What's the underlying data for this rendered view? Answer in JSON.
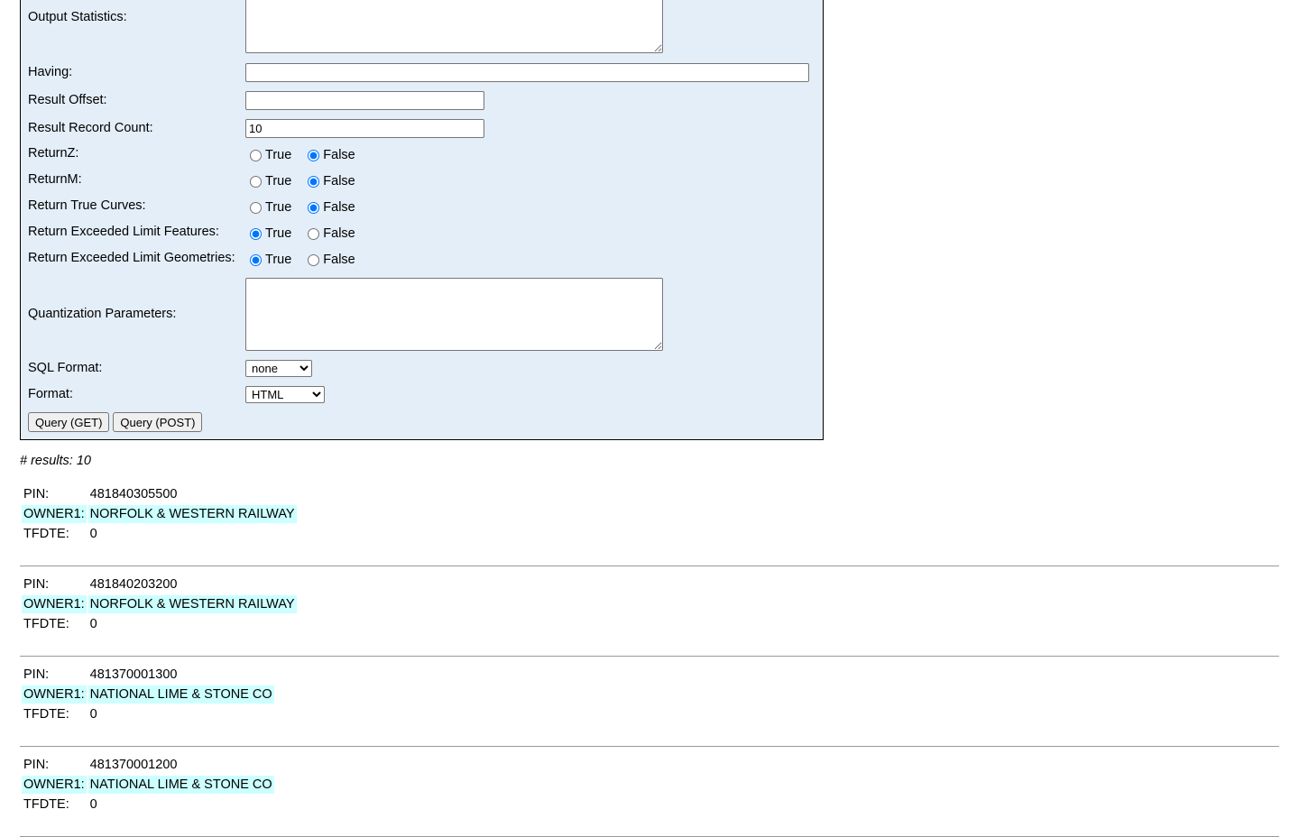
{
  "form": {
    "output_statistics": {
      "label": "Output Statistics:",
      "value": ""
    },
    "having": {
      "label": "Having:",
      "value": ""
    },
    "result_offset": {
      "label": "Result Offset:",
      "value": ""
    },
    "result_record_count": {
      "label": "Result Record Count:",
      "value": "10"
    },
    "radios": [
      {
        "label": "ReturnZ:",
        "true_label": "True",
        "false_label": "False",
        "selected": "False"
      },
      {
        "label": "ReturnM:",
        "true_label": "True",
        "false_label": "False",
        "selected": "False"
      },
      {
        "label": "Return True Curves:",
        "true_label": "True",
        "false_label": "False",
        "selected": "False"
      },
      {
        "label": "Return Exceeded Limit Features:",
        "true_label": "True",
        "false_label": "False",
        "selected": "True"
      },
      {
        "label": "Return Exceeded Limit Geometries:",
        "true_label": "True",
        "false_label": "False",
        "selected": "True"
      }
    ],
    "quantization_parameters": {
      "label": "Quantization Parameters:",
      "value": ""
    },
    "sql_format": {
      "label": "SQL Format:",
      "selected": "none"
    },
    "format": {
      "label": "Format:",
      "selected": "HTML"
    },
    "query_get_label": "Query (GET)",
    "query_post_label": "Query (POST)"
  },
  "results": {
    "count_text": "# results: 10",
    "records": [
      {
        "pin_key": "PIN:",
        "pin": "481840305500",
        "owner_key": "OWNER1:",
        "owner": "NORFOLK & WESTERN RAILWAY",
        "tfdte_key": "TFDTE:",
        "tfdte": "0"
      },
      {
        "pin_key": "PIN:",
        "pin": "481840203200",
        "owner_key": "OWNER1:",
        "owner": "NORFOLK & WESTERN RAILWAY",
        "tfdte_key": "TFDTE:",
        "tfdte": "0"
      },
      {
        "pin_key": "PIN:",
        "pin": "481370001300",
        "owner_key": "OWNER1:",
        "owner": "NATIONAL LIME & STONE CO",
        "tfdte_key": "TFDTE:",
        "tfdte": "0"
      },
      {
        "pin_key": "PIN:",
        "pin": "481370001200",
        "owner_key": "OWNER1:",
        "owner": "NATIONAL LIME & STONE CO",
        "tfdte_key": "TFDTE:",
        "tfdte": "0"
      }
    ]
  }
}
